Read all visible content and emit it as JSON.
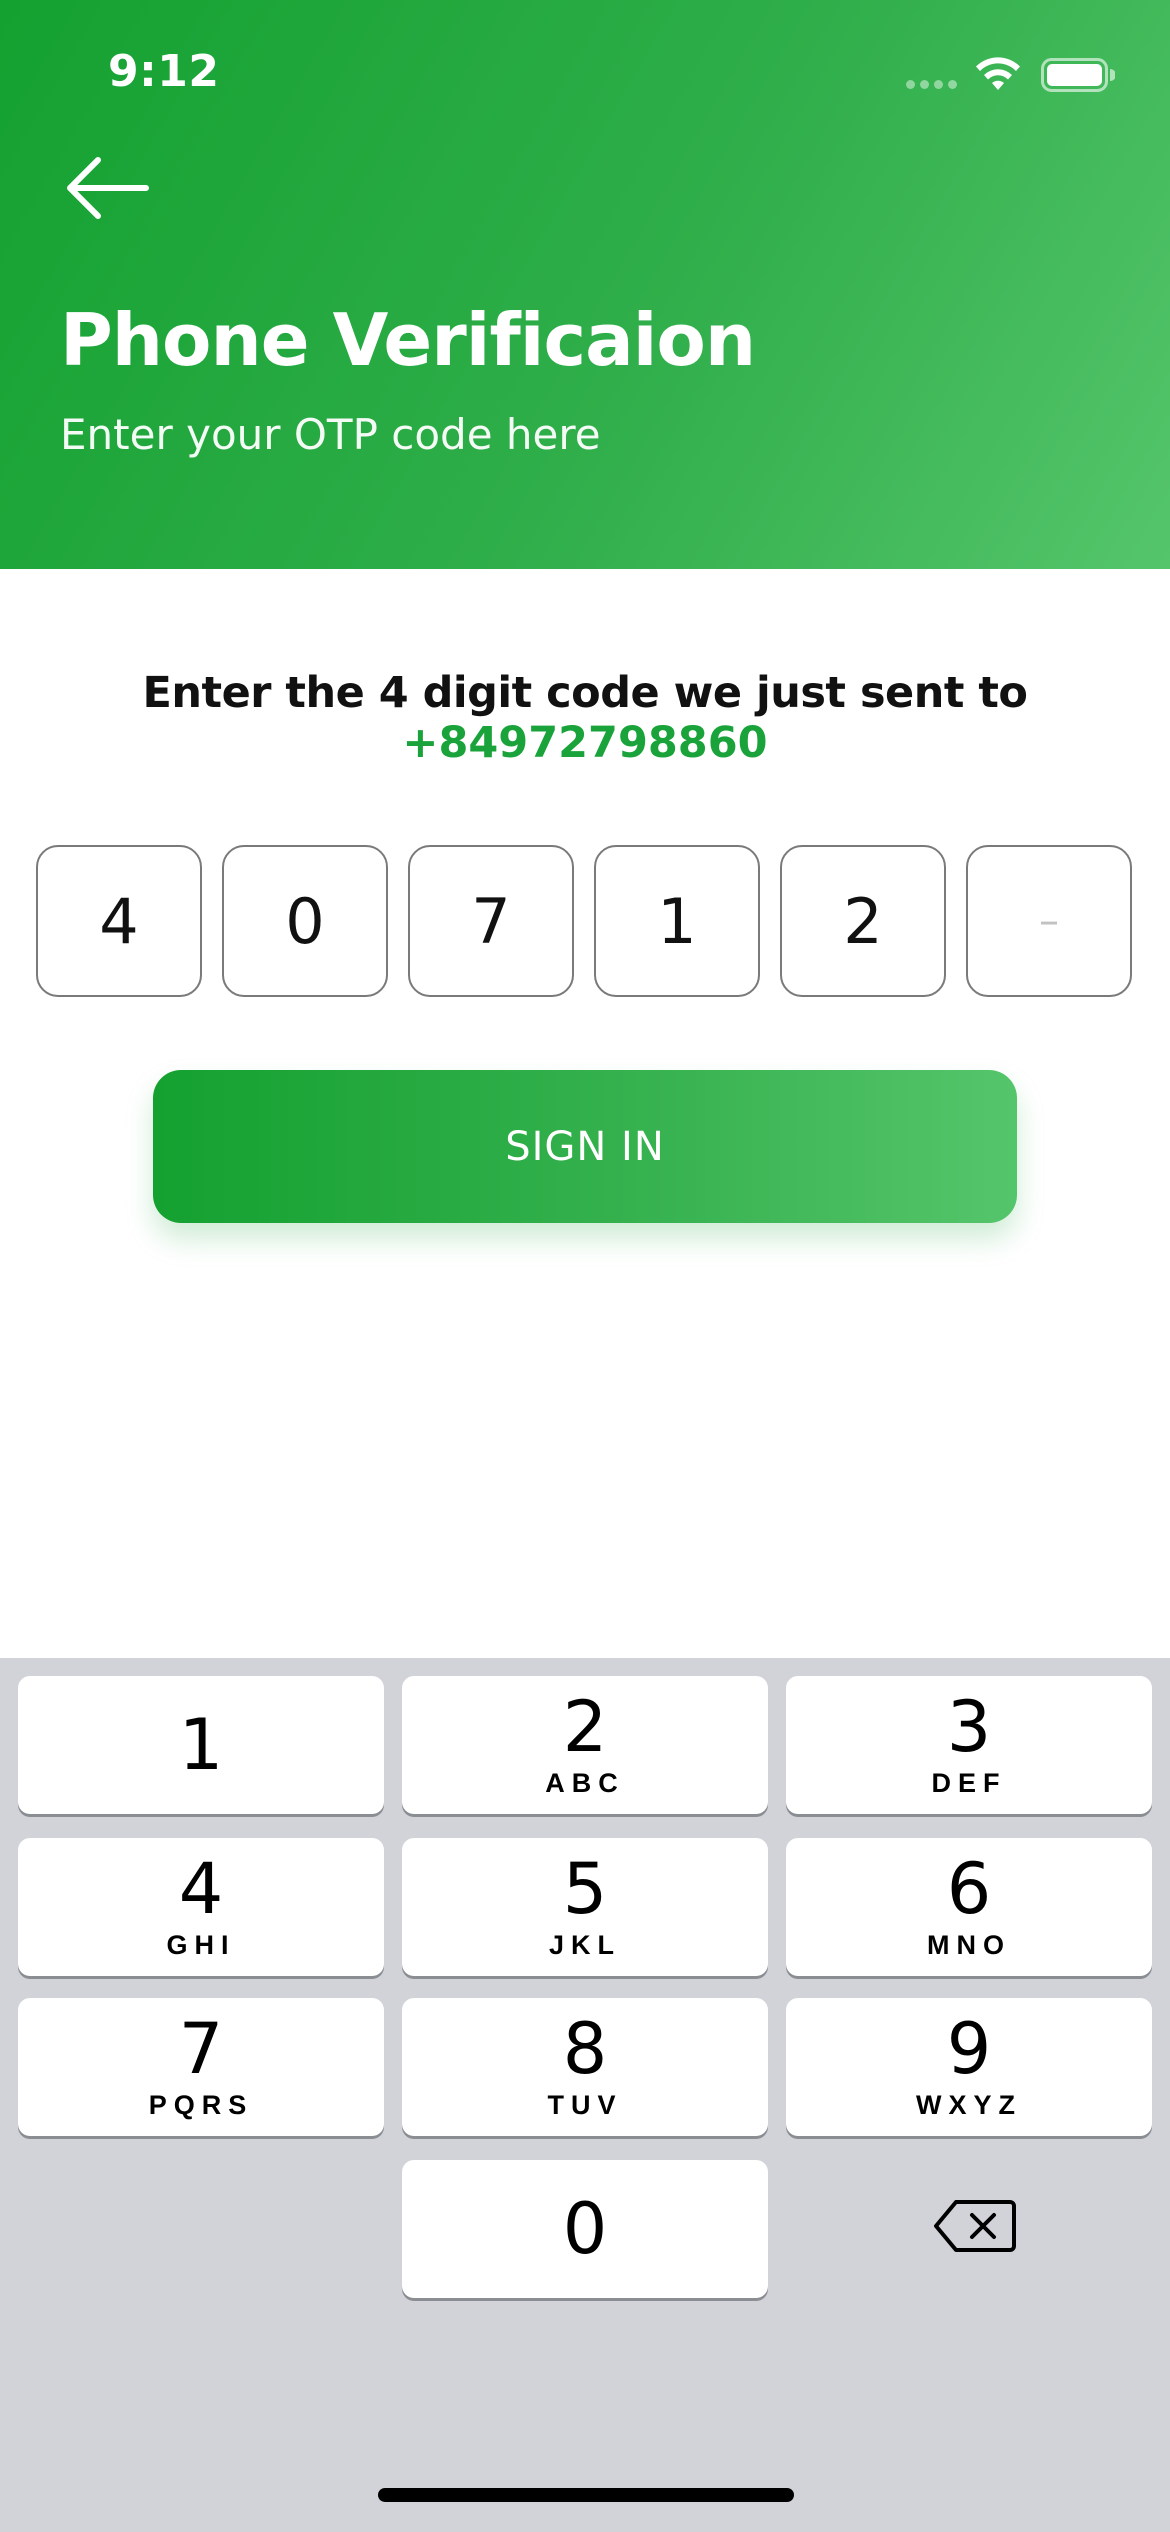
{
  "status_bar": {
    "time": "9:12"
  },
  "header": {
    "title": "Phone Verificaion",
    "subtitle": "Enter your OTP code here"
  },
  "instruction": {
    "text": "Enter the 4 digit code we just sent to",
    "phone_number": "+84972798860"
  },
  "otp": {
    "digits": [
      "4",
      "0",
      "7",
      "1",
      "2",
      "–"
    ]
  },
  "sign_in_label": "SIGN IN",
  "keypad": {
    "keys": [
      {
        "num": "1",
        "letters": ""
      },
      {
        "num": "2",
        "letters": "ABC"
      },
      {
        "num": "3",
        "letters": "DEF"
      },
      {
        "num": "4",
        "letters": "GHI"
      },
      {
        "num": "5",
        "letters": "JKL"
      },
      {
        "num": "6",
        "letters": "MNO"
      },
      {
        "num": "7",
        "letters": "PQRS"
      },
      {
        "num": "8",
        "letters": "TUV"
      },
      {
        "num": "9",
        "letters": "WXYZ"
      },
      {
        "num": "0",
        "letters": ""
      }
    ]
  },
  "colors": {
    "brand_green": "#14a130",
    "brand_green_light": "#55c56b",
    "phone_number": "#1aa33a",
    "keyboard_bg": "#d1d3d9"
  }
}
